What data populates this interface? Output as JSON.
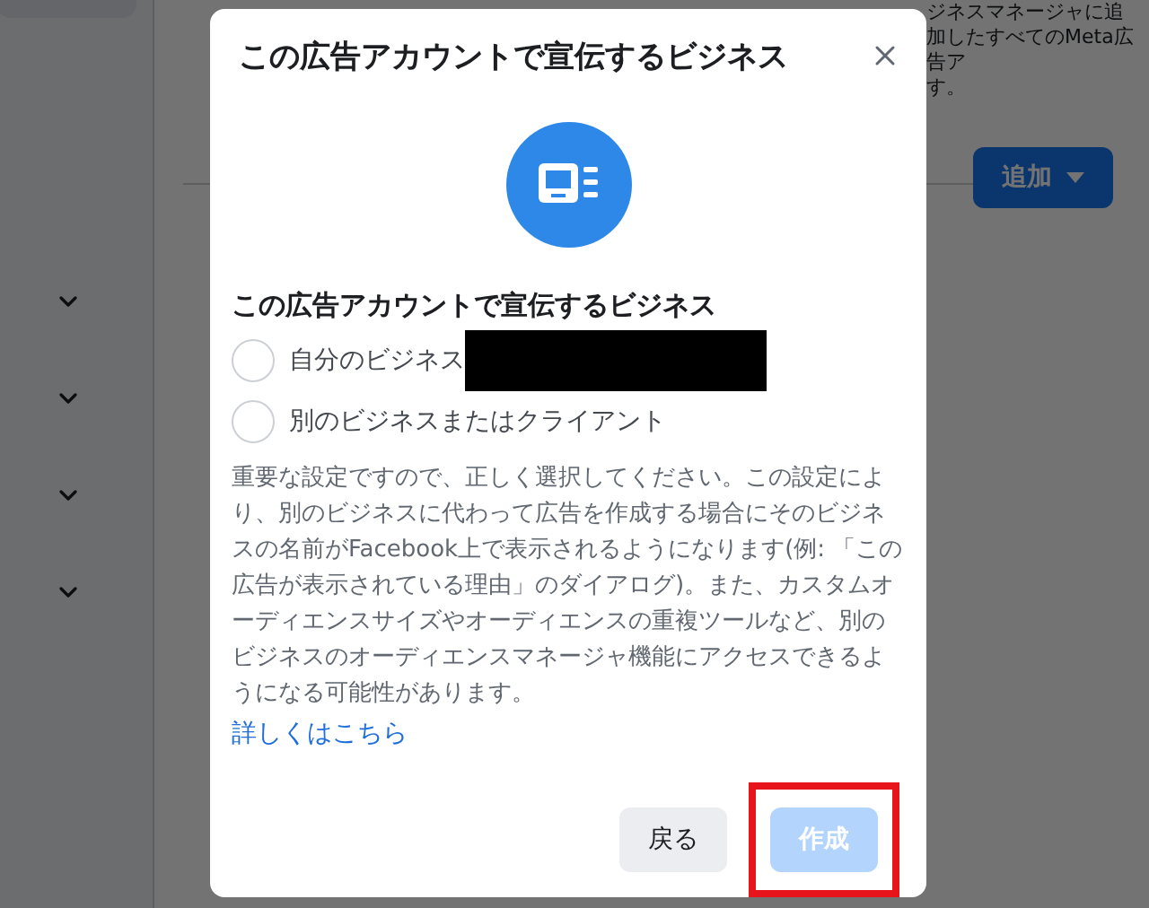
{
  "background": {
    "notice_lines": [
      "ジネスマネージャに追加したすべてのMeta広告ア",
      "す。"
    ],
    "add_button": {
      "label": "追加"
    },
    "sections": [
      {
        "expanded": false
      },
      {
        "expanded": false
      },
      {
        "expanded": false
      },
      {
        "expanded": false
      }
    ]
  },
  "dialog": {
    "title": "この広告アカウントで宣伝するビジネス",
    "subtitle": "この広告アカウントで宣伝するビジネス",
    "options": [
      {
        "label": "自分のビジネス",
        "selected": false,
        "redacted": true
      },
      {
        "label": "別のビジネスまたはクライアント",
        "selected": false,
        "redacted": false
      }
    ],
    "description": "重要な設定ですので、正しく選択してください。この設定により、別のビジネスに代わって広告を作成する場合にそのビジネスの名前がFacebook上で表示されるようになります(例: 「この広告が表示されている理由」のダイアログ)。また、カスタムオーディエンスサイズやオーディエンスの重複ツールなど、別のビジネスのオーディエンスマネージャ機能にアクセスできるようになる可能性があります。",
    "link": "詳しくはこちら",
    "buttons": [
      {
        "label": "戻る",
        "kind": "secondary",
        "disabled": false,
        "highlighted": false
      },
      {
        "label": "作成",
        "kind": "primary",
        "disabled": true,
        "highlighted": true
      }
    ]
  }
}
